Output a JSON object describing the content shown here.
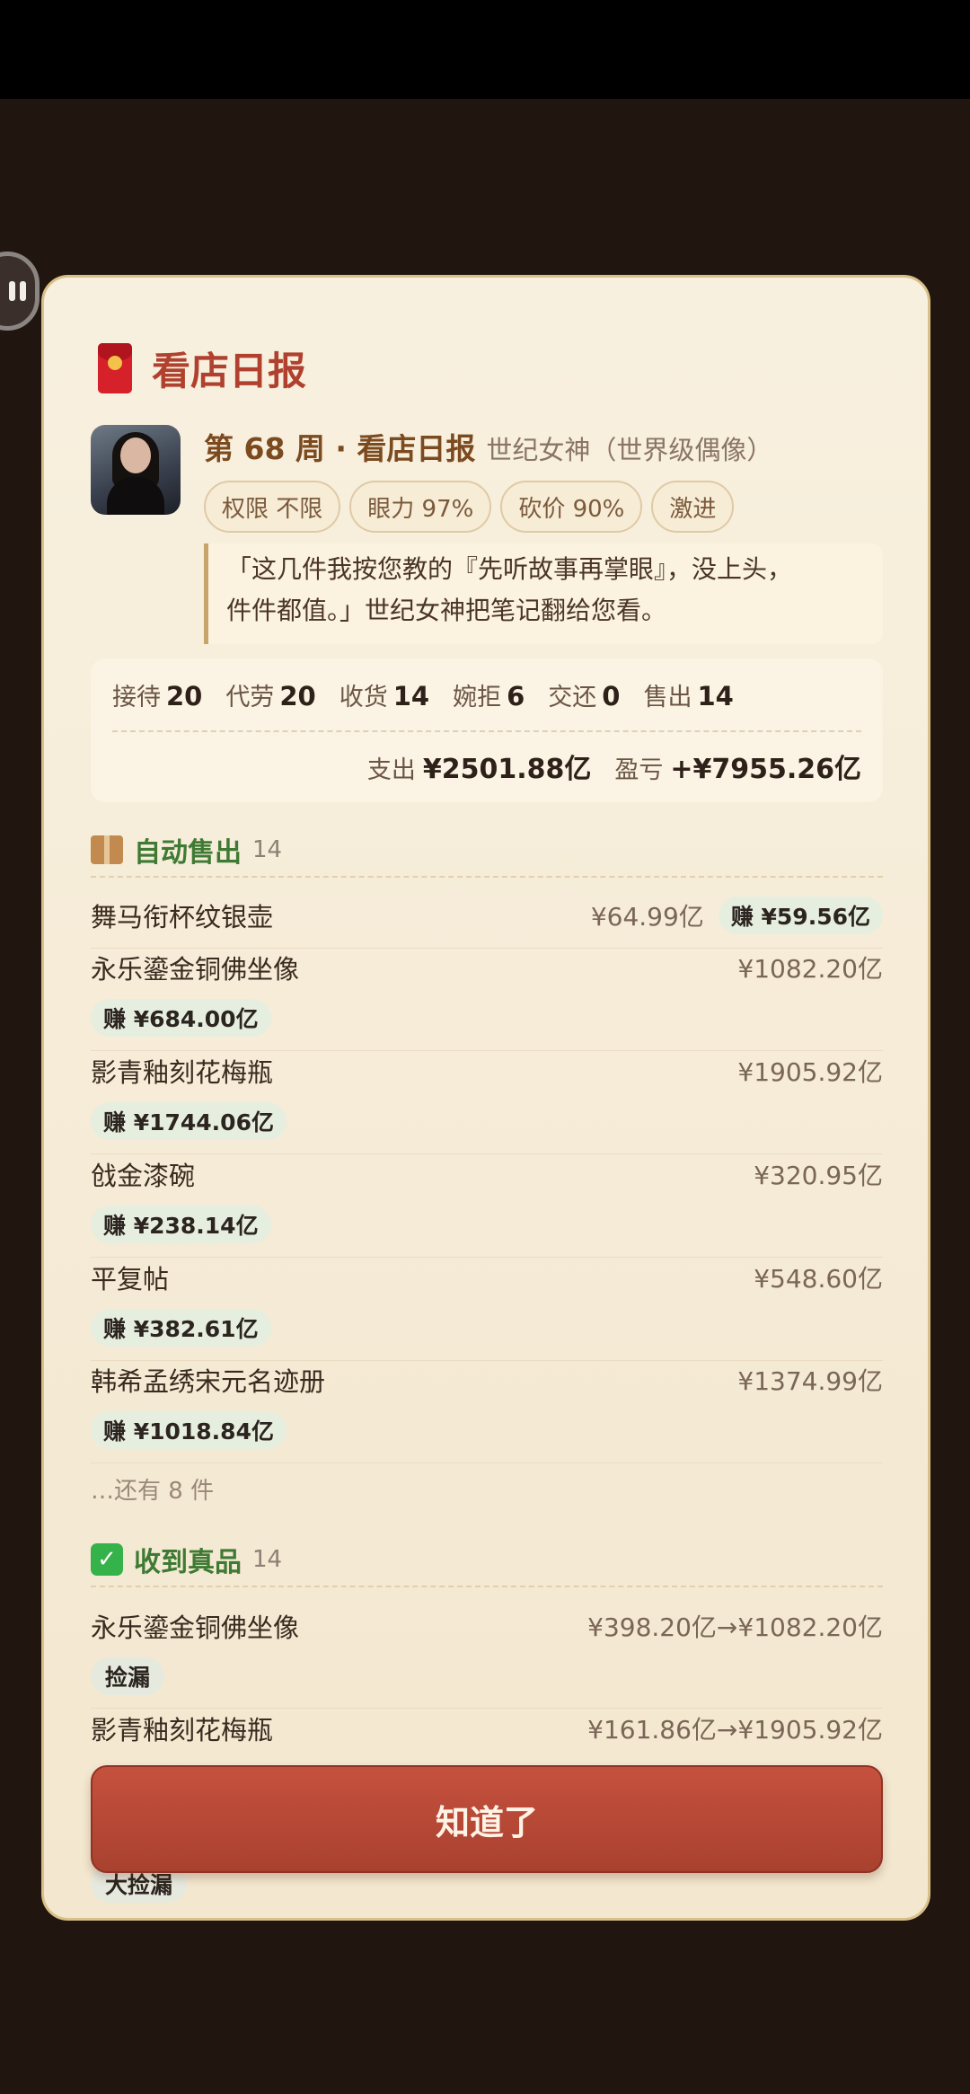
{
  "modal": {
    "title": "看店日报",
    "title_icon": "red-packet-icon",
    "week_title": "第 68 周 · 看店日报",
    "subtitle": "世纪女神（世界级偶像）",
    "chips": [
      "权限 不限",
      "眼力 97%",
      "砍价 90%",
      "激进"
    ],
    "quote_line1": "「这几件我按您教的『先听故事再掌眼』，没上头，",
    "quote_line2": "件件都值。」世纪女神把笔记翻给您看。"
  },
  "stats": [
    {
      "label": "接待",
      "value": "20"
    },
    {
      "label": "代劳",
      "value": "20"
    },
    {
      "label": "收货",
      "value": "14"
    },
    {
      "label": "婉拒",
      "value": "6"
    },
    {
      "label": "交还",
      "value": "0"
    },
    {
      "label": "售出",
      "value": "14"
    }
  ],
  "money": {
    "expense_label": "支出",
    "expense_value": "¥2501.88亿",
    "profit_label": "盈亏",
    "profit_value": "+¥7955.26亿"
  },
  "auto_sold": {
    "icon": "package-icon",
    "title": "自动售出",
    "count": "14",
    "items": [
      {
        "name": "舞马衔杯纹银壶",
        "price": "¥64.99亿",
        "earn": "赚 ¥59.56亿"
      },
      {
        "name": "永乐鎏金铜佛坐像",
        "price": "¥1082.20亿",
        "earn": "赚 ¥684.00亿"
      },
      {
        "name": "影青釉刻花梅瓶",
        "price": "¥1905.92亿",
        "earn": "赚 ¥1744.06亿"
      },
      {
        "name": "戗金漆碗",
        "price": "¥320.95亿",
        "earn": "赚 ¥238.14亿"
      },
      {
        "name": "平复帖",
        "price": "¥548.60亿",
        "earn": "赚 ¥382.61亿"
      },
      {
        "name": "韩希孟绣宋元名迹册",
        "price": "¥1374.99亿",
        "earn": "赚 ¥1018.84亿"
      }
    ],
    "more": "…还有 8 件"
  },
  "genuine": {
    "icon": "check-icon",
    "title": "收到真品",
    "count": "14",
    "items": [
      {
        "name": "永乐鎏金铜佛坐像",
        "price": "¥398.20亿→¥1082.20亿",
        "tag": "捡漏"
      },
      {
        "name": "影青釉刻花梅瓶",
        "price": "¥161.86亿→¥1905.92亿",
        "tag": "大捡漏"
      }
    ]
  },
  "ok_button": "知道了"
}
